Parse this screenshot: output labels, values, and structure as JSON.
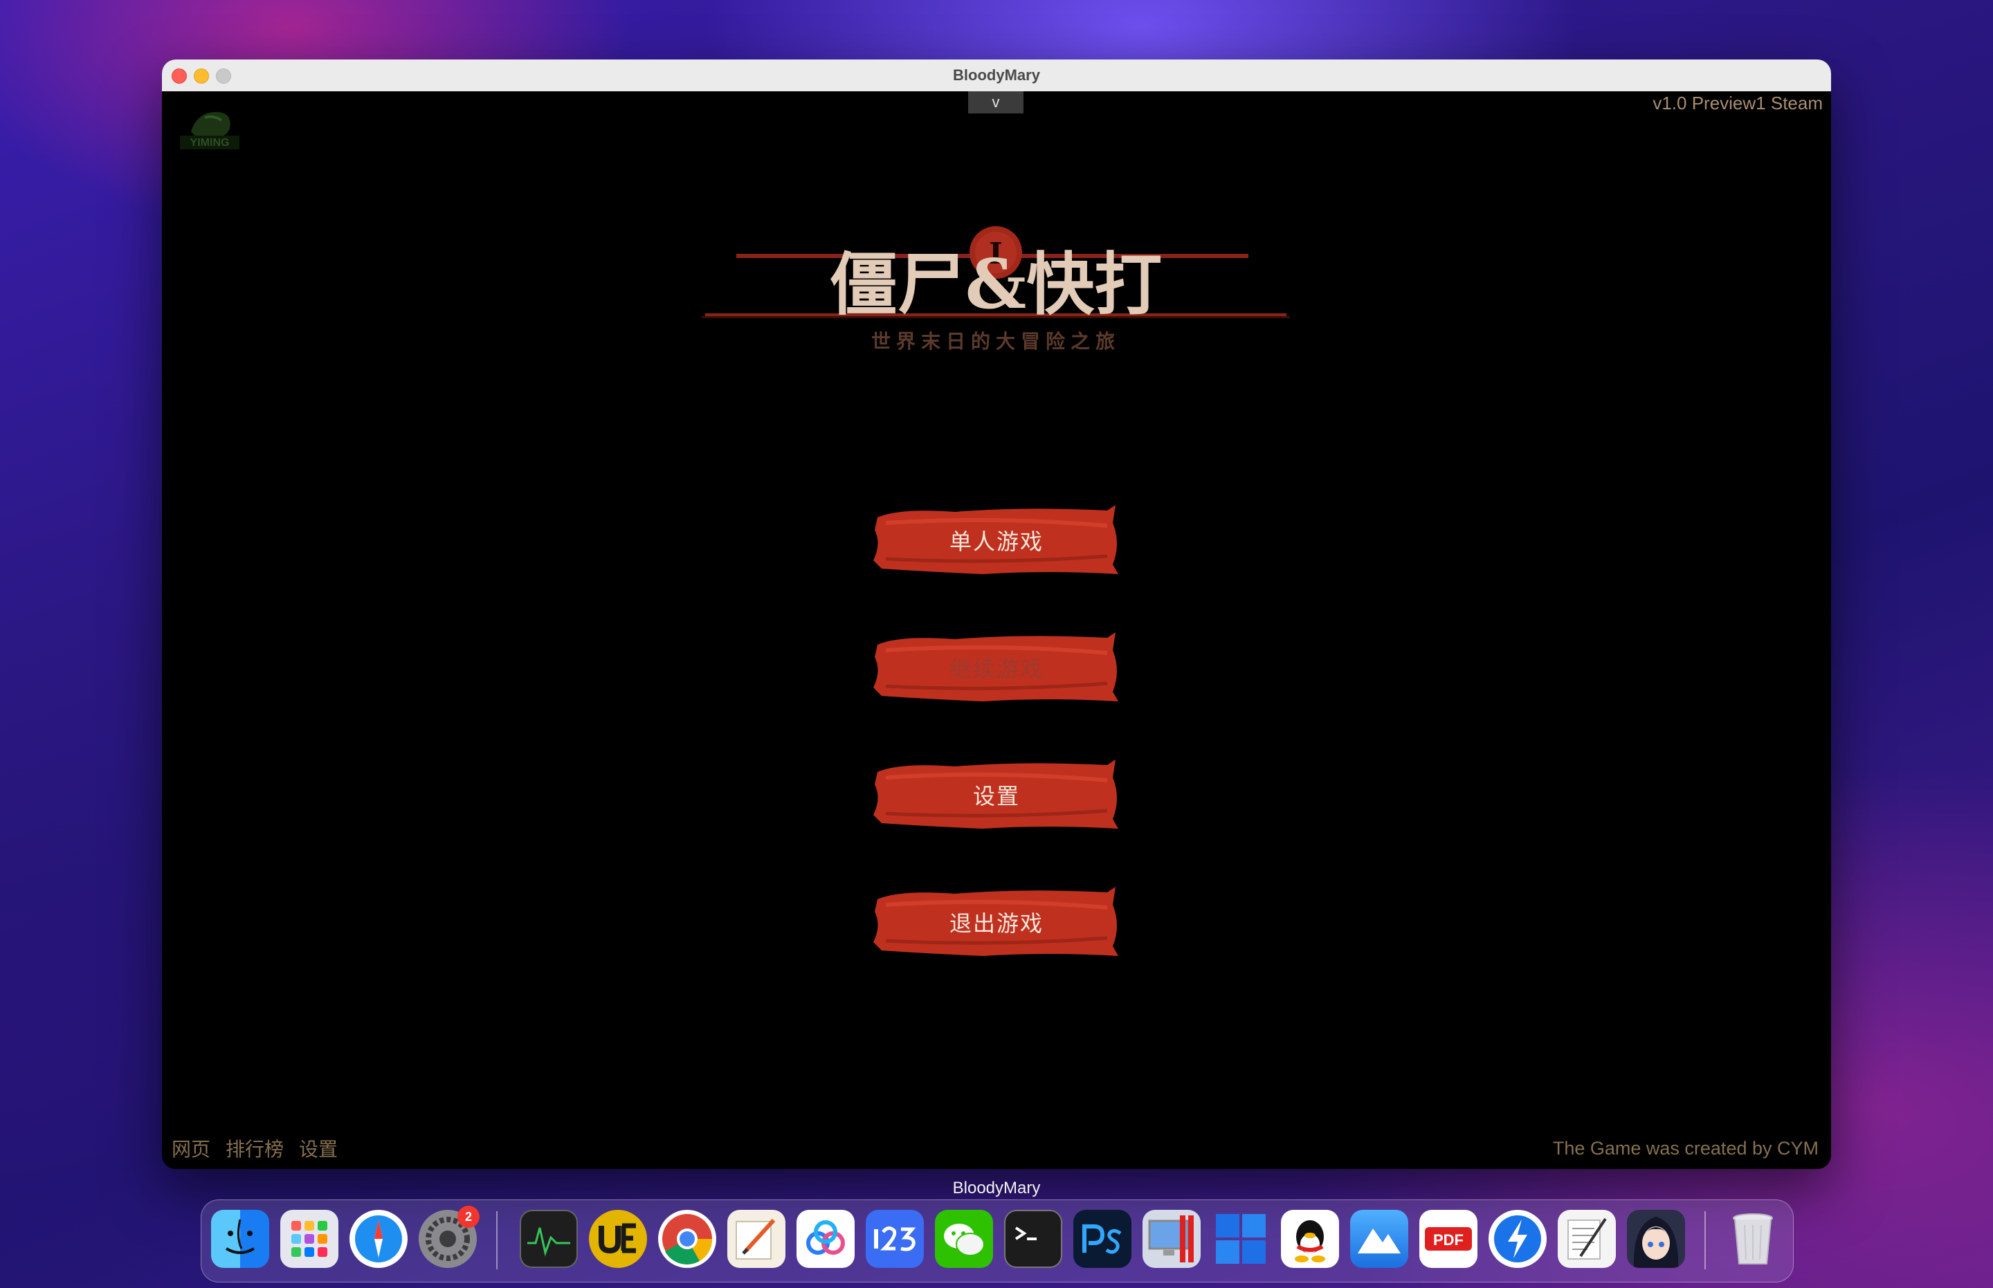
{
  "window": {
    "title": "BloodyMary"
  },
  "game": {
    "version": "v1.0 Preview1 Steam",
    "toggle_label": "v",
    "logo_text": "YIMING",
    "title_main": "僵尸&快打",
    "title_roman": "I",
    "title_sub": "世界末日的大冒险之旅",
    "menu": [
      {
        "label": "单人游戏",
        "enabled": true
      },
      {
        "label": "继续游戏",
        "enabled": false
      },
      {
        "label": "设置",
        "enabled": true
      },
      {
        "label": "退出游戏",
        "enabled": true
      }
    ],
    "bottom_links": [
      "网页",
      "排行榜",
      "设置"
    ],
    "credit": "The Game was created by CYM"
  },
  "dock": {
    "hover_label": "BloodyMary",
    "settings_badge": "2",
    "items": [
      {
        "name": "finder-icon",
        "color": "#1e8ff5"
      },
      {
        "name": "launchpad-icon",
        "color": "#e8e8ee"
      },
      {
        "name": "safari-icon",
        "color": "#ffffff"
      },
      {
        "name": "system-settings-icon",
        "color": "#8a8a8e"
      },
      {
        "name": "activity-monitor-icon",
        "color": "#202020"
      },
      {
        "name": "ultraedit-icon",
        "color": "#e3b400"
      },
      {
        "name": "chrome-icon",
        "color": "#ffffff"
      },
      {
        "name": "pages-icon",
        "color": "#f2efe6"
      },
      {
        "name": "baidu-netdisk-icon",
        "color": "#ffffff"
      },
      {
        "name": "cloud-123-icon",
        "color": "#3a6cf4"
      },
      {
        "name": "wechat-icon",
        "color": "#2dc100"
      },
      {
        "name": "terminal-icon",
        "color": "#1c1c1c"
      },
      {
        "name": "photoshop-icon",
        "color": "#0a1a33"
      },
      {
        "name": "parallels-icon",
        "color": "#cfd8e6"
      },
      {
        "name": "windows-icon",
        "color": "#1f6fe6"
      },
      {
        "name": "qq-icon",
        "color": "#ffffff"
      },
      {
        "name": "mountain-app-icon",
        "color": "#2d8cf0"
      },
      {
        "name": "pdf-expert-icon",
        "color": "#ffffff"
      },
      {
        "name": "spark-icon",
        "color": "#1a73e8"
      },
      {
        "name": "textedit-icon",
        "color": "#f4f4f4"
      },
      {
        "name": "anime-avatar-icon",
        "color": "#2b2f48"
      },
      {
        "name": "trash-icon",
        "color": "#d9d9de"
      }
    ]
  }
}
